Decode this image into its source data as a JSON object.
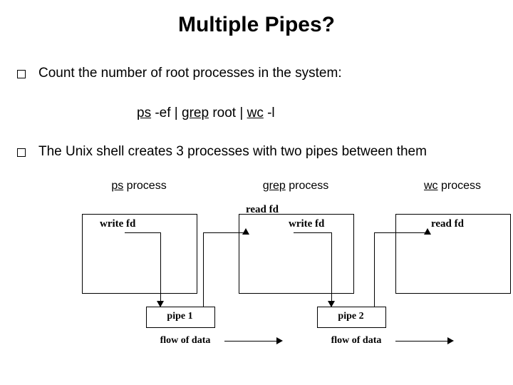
{
  "title": "Multiple Pipes?",
  "bullets": {
    "b1": "Count the number of root processes in the system:",
    "b2": "The Unix shell creates 3 processes with two pipes between them"
  },
  "command": {
    "w1a": "ps",
    "w1b": " -ef",
    "sep1": "   |   ",
    "w2a": "grep",
    "w2b": " root",
    "sep2": "   |   ",
    "w3a": "wc",
    "w3b": " -l"
  },
  "proc": {
    "p1a": "ps",
    "p1b": " process",
    "p2a": "grep",
    "p2b": " process",
    "p3a": "wc",
    "p3b": " process"
  },
  "fd": {
    "write": "write fd",
    "read": "read fd"
  },
  "pipes": {
    "p1": "pipe 1",
    "p2": "pipe 2"
  },
  "flow": "flow of data"
}
